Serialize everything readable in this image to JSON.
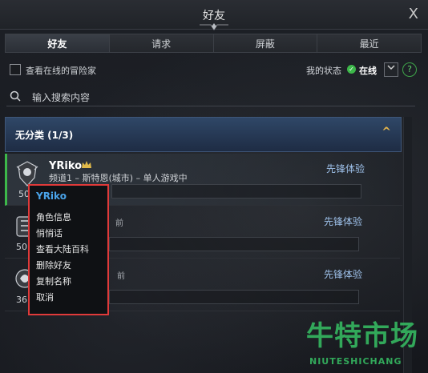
{
  "window": {
    "title": "好友",
    "close_glyph": "X"
  },
  "tabs": [
    {
      "label": "好友",
      "active": true
    },
    {
      "label": "请求",
      "active": false
    },
    {
      "label": "屏蔽",
      "active": false
    },
    {
      "label": "最近",
      "active": false
    }
  ],
  "online_filter": {
    "label": "查看在线的冒险家",
    "checked": false
  },
  "status": {
    "label": "我的状态",
    "value": "在线",
    "color": "#3db84a",
    "help_glyph": "?"
  },
  "search": {
    "placeholder": "输入搜索内容"
  },
  "group": {
    "label": "无分类 (1/3)",
    "expanded": true,
    "chevron": "^"
  },
  "friends": [
    {
      "name": "YRiko",
      "location": "频道1 – 斯特恩(城市) – 单人游戏中",
      "class_label": "先锋体验",
      "level": "50",
      "crown": true
    },
    {
      "name": "",
      "location": "",
      "class_label": "先锋体验",
      "level": "50",
      "partial": "前"
    },
    {
      "name": "",
      "location": "",
      "class_label": "先锋体验",
      "level": "36",
      "partial": "前"
    }
  ],
  "context_menu": {
    "title": "YRiko",
    "items": [
      "角色信息",
      "悄悄话",
      "查看大陆百科",
      "删除好友",
      "复制名称",
      "取消"
    ],
    "highlight_color": "#e03a3a"
  },
  "watermark": {
    "cn": "牛特市场",
    "en": "NIUTESHICHANG"
  }
}
